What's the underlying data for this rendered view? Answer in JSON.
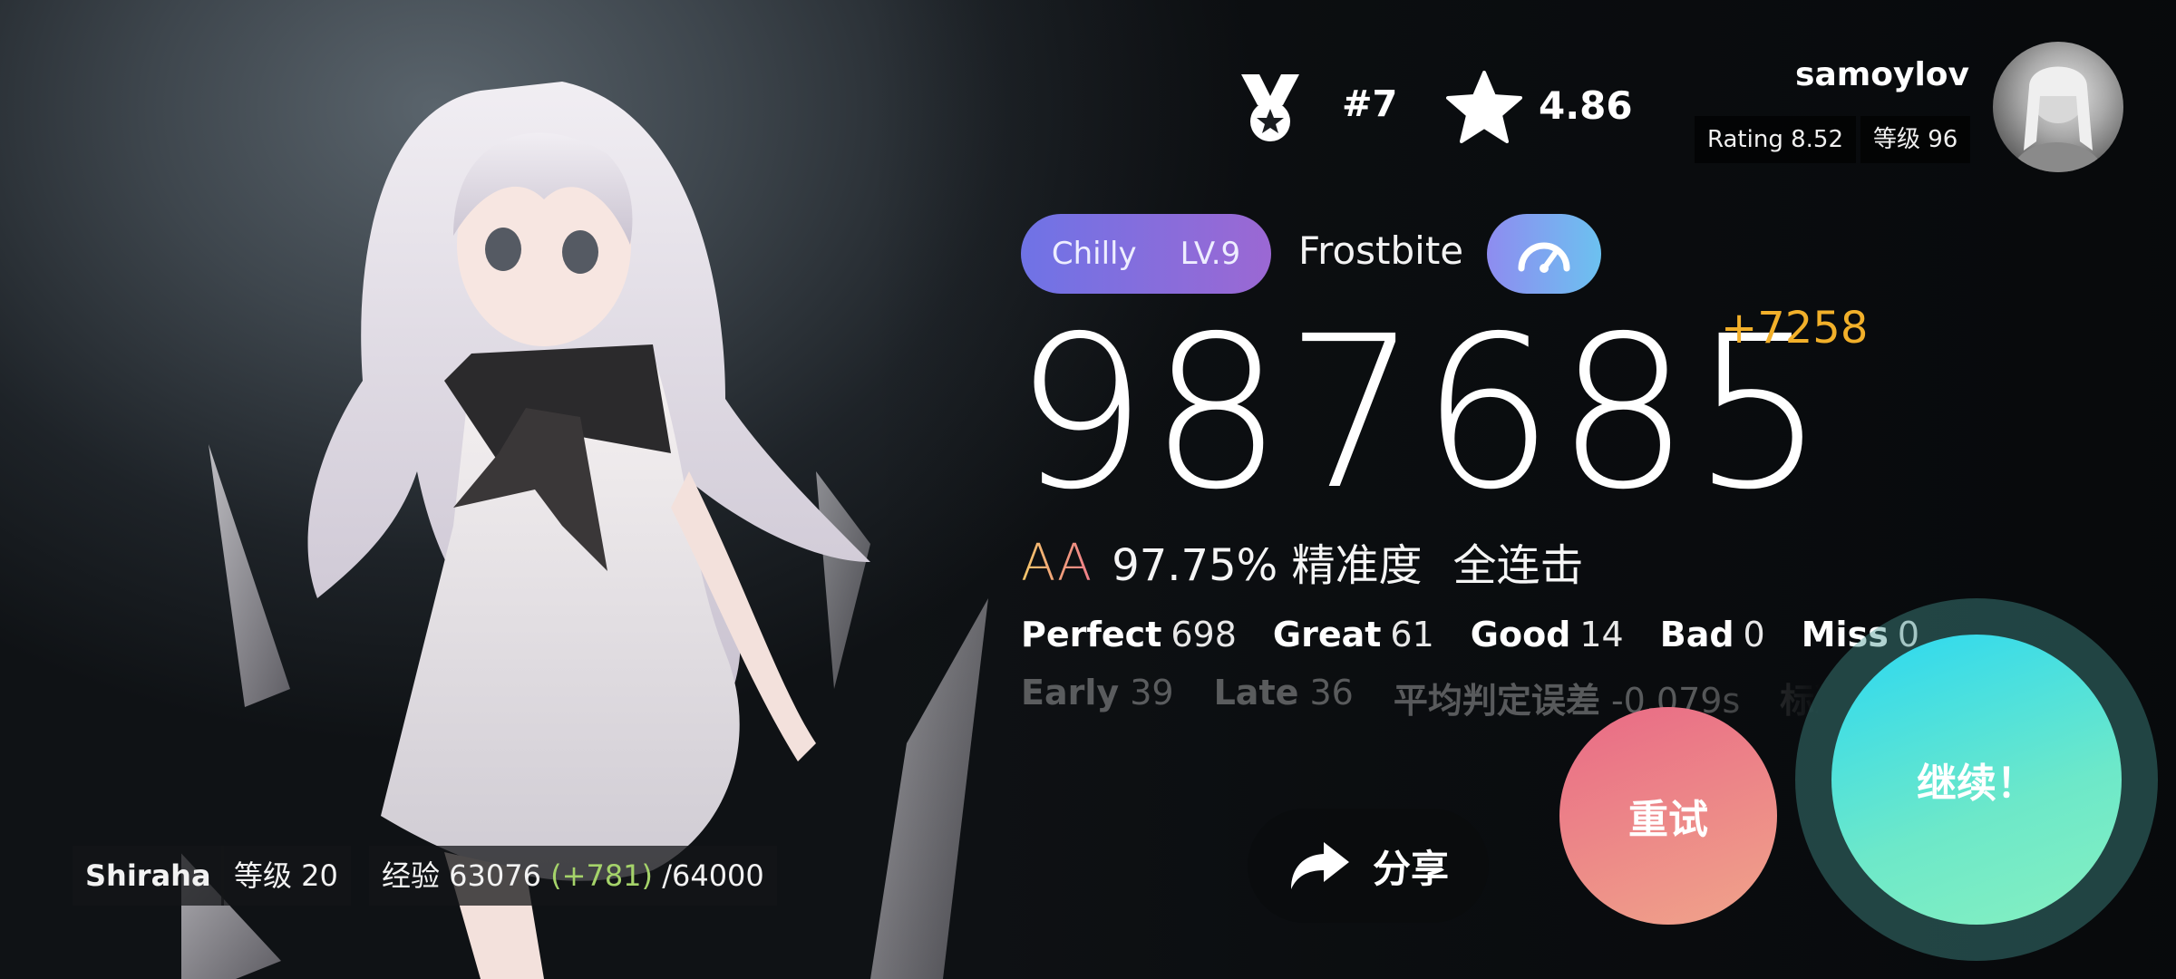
{
  "header": {
    "rank": "#7",
    "rating": "4.86",
    "username": "samoylov",
    "player_rating": "Rating 8.52",
    "account_level": "等级 96"
  },
  "song": {
    "difficulty_name": "Chilly",
    "difficulty_level": "LV.9",
    "title": "Frostbite"
  },
  "result": {
    "score": "987685",
    "score_delta": "+7258",
    "grade": "AA",
    "accuracy": "97.75% 精准度",
    "full_combo": "全连击"
  },
  "judgements": [
    {
      "label": "Perfect",
      "value": "698"
    },
    {
      "label": "Great",
      "value": "61"
    },
    {
      "label": "Good",
      "value": "14"
    },
    {
      "label": "Bad",
      "value": "0"
    },
    {
      "label": "Miss",
      "value": "0"
    }
  ],
  "timing": [
    {
      "label": "Early",
      "value": "39"
    },
    {
      "label": "Late",
      "value": "36"
    },
    {
      "label": "平均判定误差",
      "value": "-0.079s"
    },
    {
      "label": "标准判定",
      "value": ""
    }
  ],
  "player": {
    "character_name": "Shiraha",
    "level": "等级 20",
    "exp_prefix": "经验 63076",
    "exp_gain": "(+781)",
    "exp_total": "/64000"
  },
  "actions": {
    "share": "分享",
    "retry": "重试",
    "continue": "继续！"
  },
  "colors": {
    "score_delta": "#f2b02a",
    "exp_gain": "#a5d36a",
    "difficulty_pill": "#7d6fe0",
    "retry": "#ec8088",
    "continue": "#4fe0d8"
  },
  "icons": {
    "rank": "medal-icon",
    "rating": "star-icon",
    "speed": "speedometer-icon",
    "share": "share-arrow-icon"
  }
}
